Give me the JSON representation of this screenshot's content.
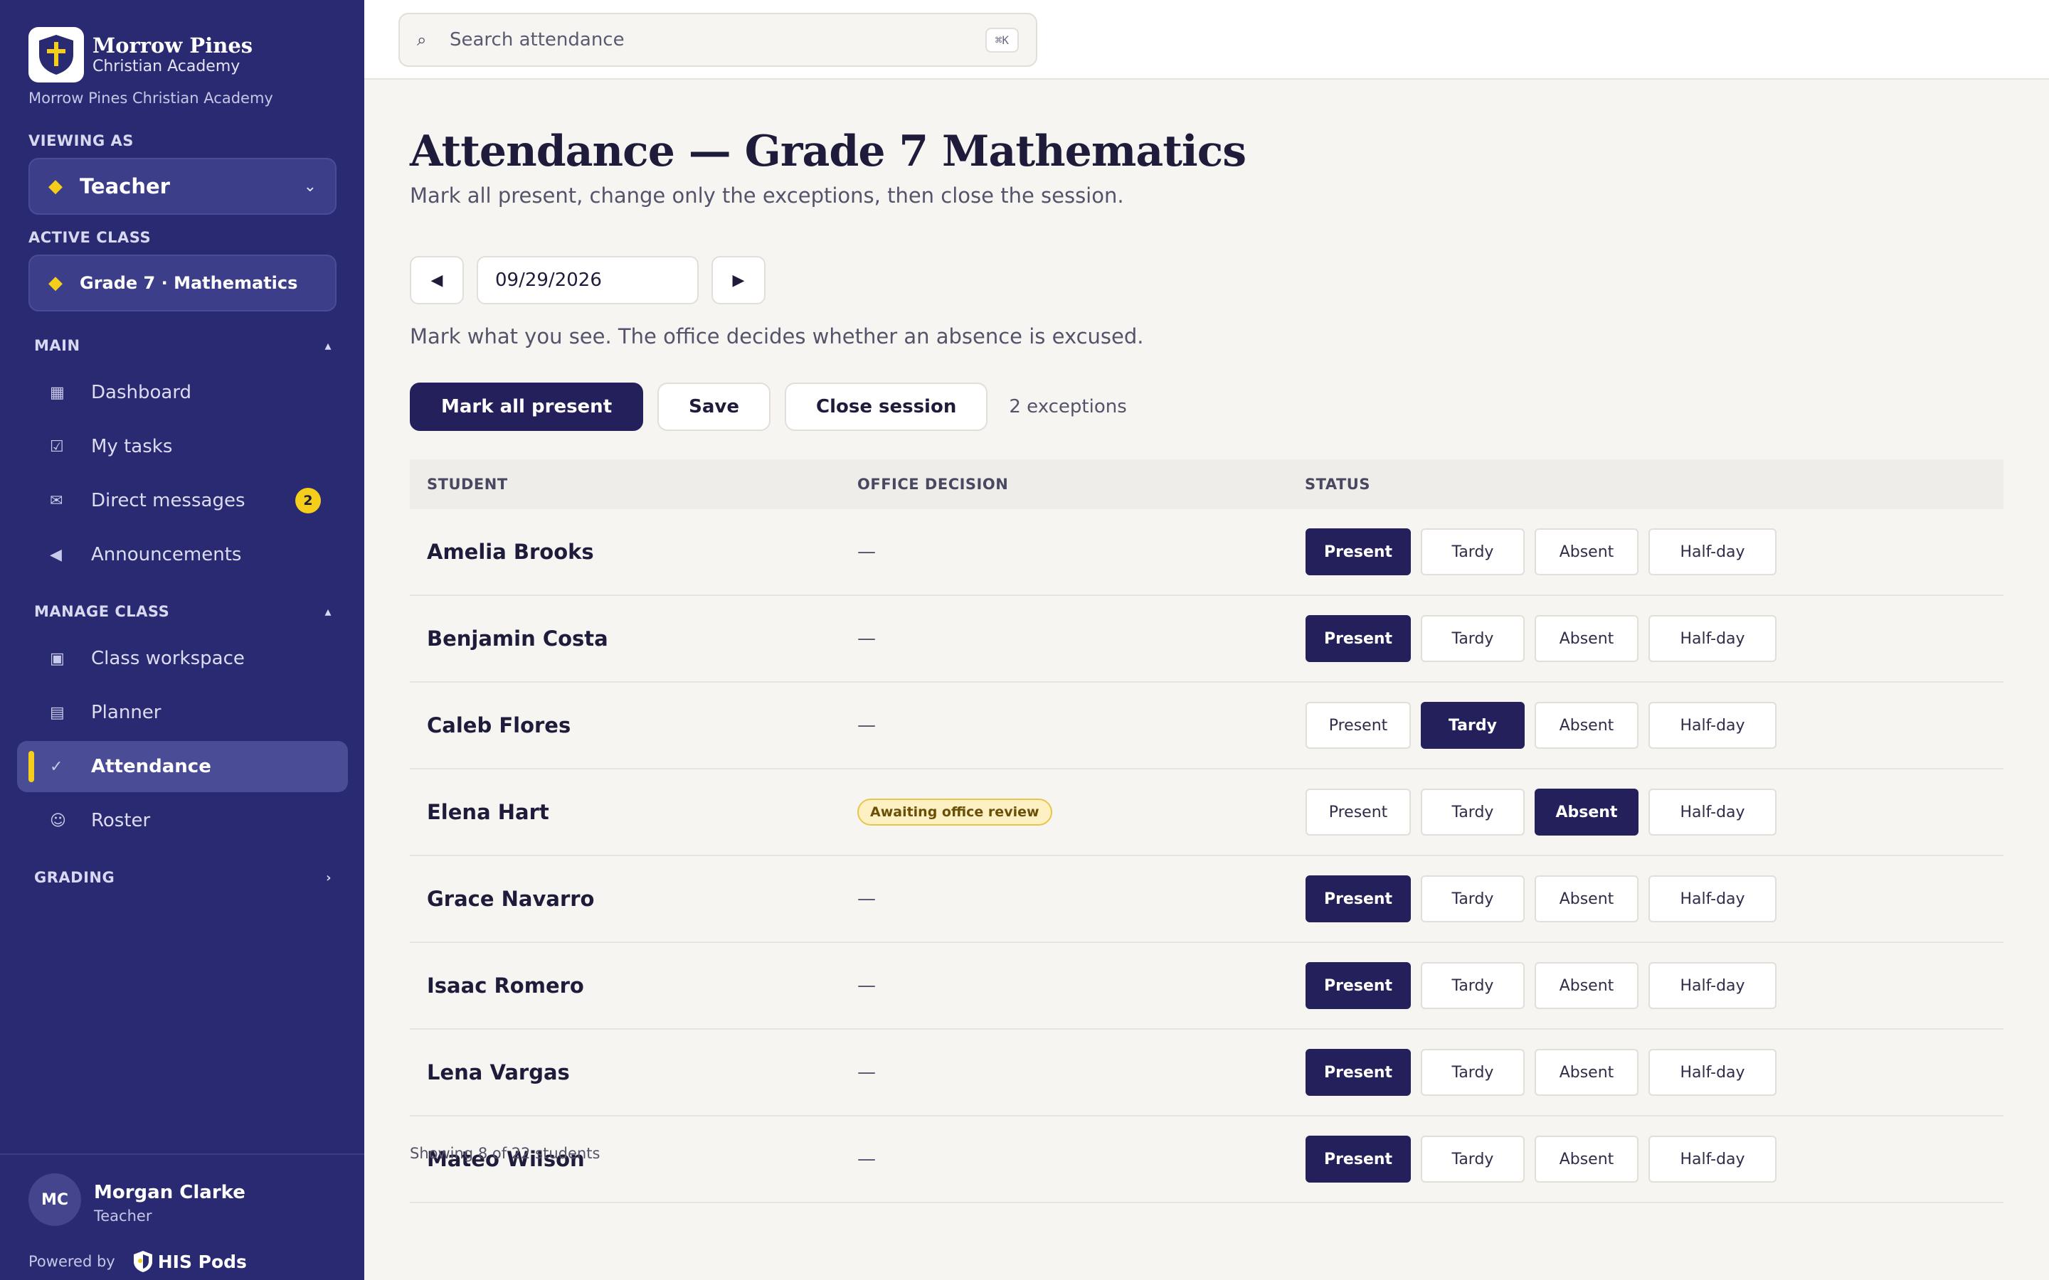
{
  "brand": {
    "name": "Morrow Pines",
    "subtitle": "Christian Academy",
    "school_line": "Morrow Pines Christian Academy"
  },
  "sidebar": {
    "viewing_as_label": "VIEWING AS",
    "viewing_as_value": "Teacher",
    "active_class_label": "ACTIVE CLASS",
    "active_class_value": "Grade 7 · Mathematics",
    "sections": {
      "main": "MAIN",
      "manage_class": "MANAGE CLASS",
      "grading": "GRADING"
    },
    "main_items": [
      {
        "label": "Dashboard",
        "icon": "dashboard-icon"
      },
      {
        "label": "My tasks",
        "icon": "tasks-icon"
      },
      {
        "label": "Direct messages",
        "icon": "message-icon",
        "badge": "2"
      },
      {
        "label": "Announcements",
        "icon": "megaphone-icon"
      }
    ],
    "manage_items": [
      {
        "label": "Class workspace",
        "icon": "workspace-icon"
      },
      {
        "label": "Planner",
        "icon": "calendar-icon"
      },
      {
        "label": "Attendance",
        "icon": "checklist-icon",
        "active": true
      },
      {
        "label": "Roster",
        "icon": "people-icon"
      }
    ],
    "user": {
      "initials": "MC",
      "name": "Morgan Clarke",
      "role": "Teacher"
    },
    "powered_by": "Powered by",
    "powered_logo": "HIS Pods",
    "accent_color": "#f5cd1b",
    "bg_color": "#2a2a73"
  },
  "topbar": {
    "search_placeholder": "Search attendance",
    "shortcut": "⌘K"
  },
  "page": {
    "title": "Attendance — Grade 7 Mathematics",
    "subtitle": "Mark all present, change only the exceptions, then close the session.",
    "date": "09/29/2026",
    "note": "Mark what you see. The office decides whether an absence is excused.",
    "actions": {
      "mark_all": "Mark all present",
      "save": "Save",
      "close": "Close session",
      "exceptions": "2 exceptions"
    },
    "table": {
      "headers": {
        "student": "STUDENT",
        "office": "OFFICE DECISION",
        "status": "STATUS"
      },
      "status_options": [
        "Present",
        "Tardy",
        "Absent",
        "Half-day"
      ],
      "rows": [
        {
          "student": "Amelia Brooks",
          "office": "—",
          "status": "Present"
        },
        {
          "student": "Benjamin Costa",
          "office": "—",
          "status": "Present"
        },
        {
          "student": "Caleb Flores",
          "office": "—",
          "status": "Tardy"
        },
        {
          "student": "Elena Hart",
          "office": "Awaiting office review",
          "office_pill": true,
          "status": "Absent"
        },
        {
          "student": "Grace Navarro",
          "office": "—",
          "status": "Present"
        },
        {
          "student": "Isaac Romero",
          "office": "—",
          "status": "Present"
        },
        {
          "student": "Lena Vargas",
          "office": "—",
          "status": "Present"
        },
        {
          "student": "Mateo Wilson",
          "office": "—",
          "status": "Present"
        }
      ]
    },
    "footer": "Showing 8 of 22 students"
  }
}
